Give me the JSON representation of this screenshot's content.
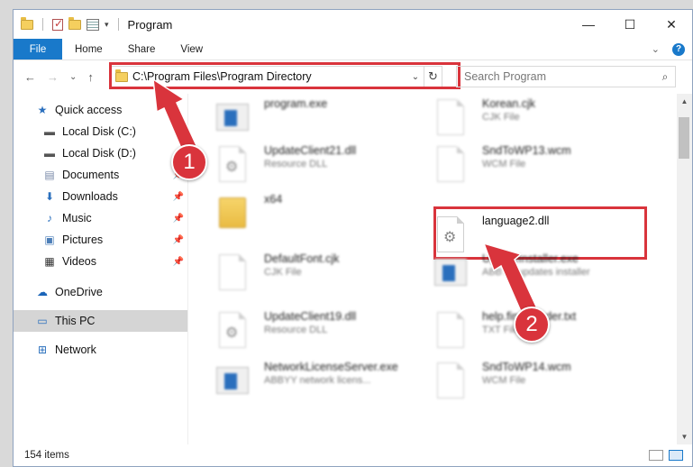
{
  "window": {
    "title": "Program",
    "controls": {
      "minimize": "—",
      "maximize": "☐",
      "close": "✕"
    }
  },
  "ribbon": {
    "tabs": [
      "File",
      "Home",
      "Share",
      "View"
    ],
    "expand": "⌄",
    "help": "?"
  },
  "nav": {
    "back": "←",
    "forward": "→",
    "recent": "⌄",
    "up": "↑"
  },
  "address": {
    "path": "C:\\Program Files\\Program Directory",
    "dropdown": "⌄",
    "refresh": "↻"
  },
  "search": {
    "placeholder": "Search Program",
    "icon": "⌕"
  },
  "sidebar": {
    "items": [
      {
        "label": "Quick access",
        "icon": "★",
        "color": "#2a6fbd"
      },
      {
        "label": "Local Disk (C:)",
        "icon": "▬",
        "color": "#555555"
      },
      {
        "label": "Local Disk (D:)",
        "icon": "▬",
        "color": "#555555"
      },
      {
        "label": "Documents",
        "icon": "▤",
        "color": "#7a8aa8",
        "pin": "📌"
      },
      {
        "label": "Downloads",
        "icon": "⬇",
        "color": "#2a6fbd",
        "pin": "📌"
      },
      {
        "label": "Music",
        "icon": "♪",
        "color": "#2a6fbd",
        "pin": "📌"
      },
      {
        "label": "Pictures",
        "icon": "▣",
        "color": "#4d7fb8",
        "pin": "📌"
      },
      {
        "label": "Videos",
        "icon": "▦",
        "color": "#333333",
        "pin": "📌"
      },
      {
        "label": "OneDrive",
        "icon": "☁",
        "color": "#1a64b8"
      },
      {
        "label": "This PC",
        "icon": "▭",
        "color": "#2a6fbd"
      },
      {
        "label": "Network",
        "icon": "⊞",
        "color": "#2a6fbd"
      }
    ]
  },
  "files": [
    {
      "name": "program.exe",
      "desc": "",
      "kind": "exe"
    },
    {
      "name": "Korean.cjk",
      "desc": "CJK File",
      "kind": "doc"
    },
    {
      "name": "UpdateClient21.dll",
      "desc": "Resource DLL",
      "kind": "dll"
    },
    {
      "name": "SndToWP13.wcm",
      "desc": "WCM File",
      "kind": "doc"
    },
    {
      "name": "x64",
      "desc": "",
      "kind": "folder"
    },
    {
      "name": "language2.dll",
      "desc": "",
      "kind": "dll"
    },
    {
      "name": "DefaultFont.cjk",
      "desc": "CJK File",
      "kind": "doc"
    },
    {
      "name": "UpdateInstaller.exe",
      "desc": "ABBYY updates installer",
      "kind": "exe"
    },
    {
      "name": "UpdateClient19.dll",
      "desc": "Resource DLL",
      "kind": "dll"
    },
    {
      "name": "help.fineReader.txt",
      "desc": "TXT File",
      "kind": "doc"
    },
    {
      "name": "NetworkLicenseServer.exe",
      "desc": "ABBYY network licens...",
      "kind": "exe"
    },
    {
      "name": "SndToWP14.wcm",
      "desc": "WCM File",
      "kind": "doc"
    }
  ],
  "annotations": {
    "step1": "1",
    "step2": "2",
    "accent": "#d9343c"
  },
  "status": {
    "count": "154 items"
  }
}
